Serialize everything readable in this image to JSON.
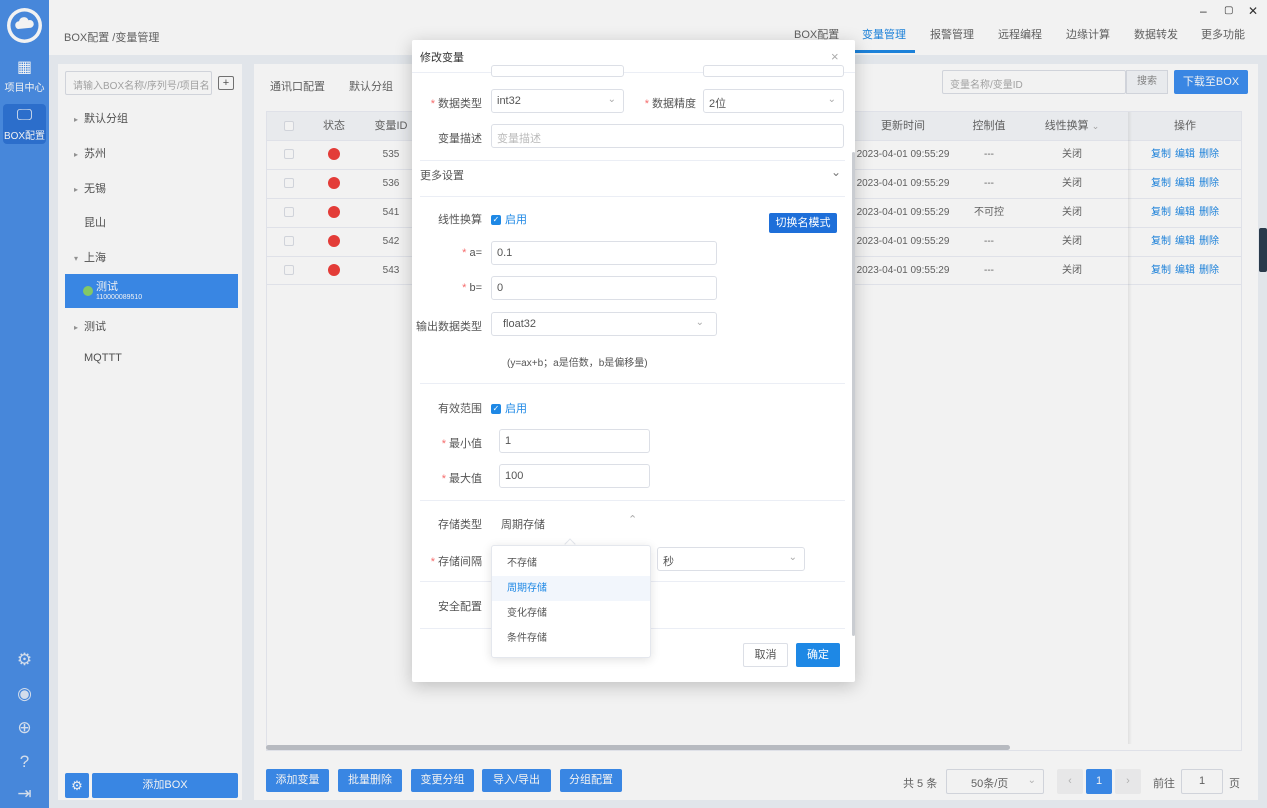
{
  "rail": {
    "items": [
      {
        "label": "项目中心",
        "icon": "grid-icon"
      },
      {
        "label": "BOX配置",
        "icon": "monitor-icon"
      }
    ],
    "bottom_icons": [
      "settings-icon",
      "user-icon",
      "globe-icon",
      "help-icon",
      "exit-icon"
    ]
  },
  "header": {
    "breadcrumb": "BOX配置 /变量管理",
    "tabs": [
      "BOX配置",
      "变量管理",
      "报警管理",
      "远程编程",
      "边缘计算",
      "数据转发",
      "更多功能"
    ],
    "active_tab": "变量管理",
    "window_controls": [
      "–",
      "▢",
      "✕"
    ]
  },
  "sidebar": {
    "search_placeholder": "请输入BOX名称/序列号/项目名",
    "add_icon": "folder-add-icon",
    "tree": [
      {
        "label": "默认分组",
        "arrow": "▸"
      },
      {
        "label": "苏州",
        "arrow": "▸"
      },
      {
        "label": "无锡",
        "arrow": "▸"
      },
      {
        "label": "昆山",
        "arrow": ""
      },
      {
        "label": "上海",
        "arrow": "▾"
      },
      {
        "label": "测试",
        "arrow": "▸"
      },
      {
        "label": "MQTTT",
        "arrow": ""
      }
    ],
    "selected": {
      "name": "测试",
      "serial": "110000089510",
      "status_color": "#8bd36b"
    },
    "add_box_label": "添加BOX"
  },
  "main": {
    "sub_tabs": [
      "通讯口配置",
      "默认分组"
    ],
    "search_placeholder": "变量名称/变量ID",
    "search_label": "搜索",
    "download_label": "下载至BOX",
    "columns": [
      "状态",
      "变量ID",
      "更新时间",
      "控制值",
      "线性换算",
      "操作"
    ],
    "rows": [
      {
        "id": "535",
        "time": "2023-04-01 09:55:29",
        "control": "---",
        "linear": "关闭"
      },
      {
        "id": "536",
        "time": "2023-04-01 09:55:29",
        "control": "---",
        "linear": "关闭"
      },
      {
        "id": "541",
        "time": "2023-04-01 09:55:29",
        "control": "不可控",
        "linear": "关闭"
      },
      {
        "id": "542",
        "time": "2023-04-01 09:55:29",
        "control": "---",
        "linear": "关闭"
      },
      {
        "id": "543",
        "time": "2023-04-01 09:55:29",
        "control": "---",
        "linear": "关闭"
      }
    ],
    "row_actions": [
      "复制",
      "编辑",
      "删除"
    ],
    "status_color": "#f0403c",
    "bottom_buttons": [
      "添加变量",
      "批量删除",
      "变更分组",
      "导入/导出",
      "分组配置"
    ],
    "pager": {
      "total": "共 5 条",
      "page_size": "50条/页",
      "current": "1",
      "goto_label": "前往",
      "goto_value": "1",
      "page_label": "页"
    }
  },
  "dialog": {
    "title": "修改变量",
    "data_type_label": "数据类型",
    "data_type_value": "int32",
    "precision_label": "数据精度",
    "precision_value": "2位",
    "desc_label": "变量描述",
    "desc_placeholder": "变量描述",
    "more_settings": "更多设置",
    "linear_label": "线性换算",
    "linear_enabled": "启用",
    "switch_mode": "切换名模式",
    "a_label": "a=",
    "a_value": "0.1",
    "b_label": "b=",
    "b_value": "0",
    "output_type_label": "输出数据类型",
    "output_type_value": "float32",
    "formula": "(y=ax+b；a是倍数，b是偏移量)",
    "range_label": "有效范围",
    "range_enabled": "启用",
    "min_label": "最小值",
    "min_value": "1",
    "max_label": "最大值",
    "max_value": "100",
    "storage_type_label": "存储类型",
    "storage_type_value": "周期存储",
    "storage_interval_label": "存储间隔",
    "storage_unit": "秒",
    "security_label": "安全配置",
    "cancel": "取消",
    "ok": "确定",
    "dropdown_options": [
      "不存储",
      "周期存储",
      "变化存储",
      "条件存储"
    ],
    "dropdown_selected": "周期存储"
  }
}
